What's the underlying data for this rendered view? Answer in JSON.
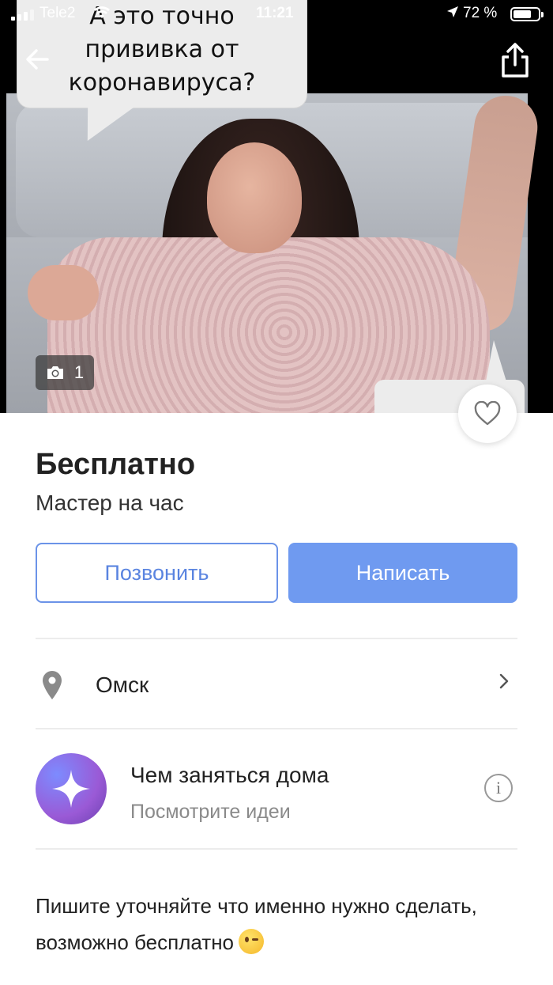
{
  "status_bar": {
    "carrier": "Tele2",
    "time": "11:21",
    "battery_percent_label": "72 %",
    "battery_level": 0.72
  },
  "photo": {
    "meme_top_text": "А это точно прививка от коронавируса?",
    "photo_count": "1"
  },
  "listing": {
    "price": "Бесплатно",
    "category": "Мастер на час"
  },
  "actions": {
    "call_label": "Позвонить",
    "write_label": "Написать"
  },
  "location": {
    "city": "Омск"
  },
  "promo": {
    "title": "Чем заняться дома",
    "subtitle": "Посмотрите идеи"
  },
  "description": "Пишите уточняйте что именно нужно сделать, возможно бесплатно",
  "colors": {
    "accent": "#6f9af0",
    "outline": "#6b93e8",
    "divider": "#ececec"
  },
  "icons": [
    "back-arrow-icon",
    "share-icon",
    "camera-icon",
    "heart-icon",
    "location-pin-icon",
    "chevron-right-icon",
    "star-sparkle-icon",
    "info-icon",
    "wink-emoji-icon"
  ]
}
